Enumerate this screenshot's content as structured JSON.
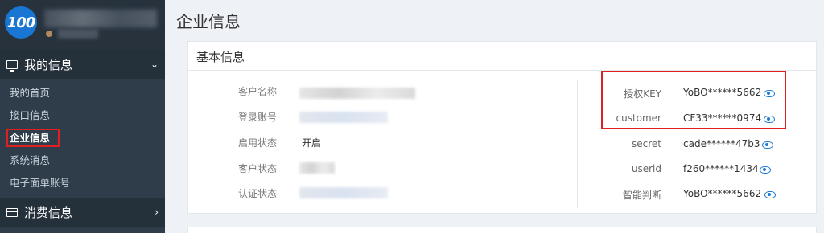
{
  "sidebar": {
    "logo_text": "100",
    "groups": [
      {
        "label": "我的信息",
        "icon": "monitor-icon",
        "chevron": "⌄"
      },
      {
        "label": "消费信息",
        "icon": "card-icon",
        "chevron": "›"
      }
    ],
    "items": [
      {
        "label": "我的首页"
      },
      {
        "label": "接口信息"
      },
      {
        "label": "企业信息",
        "active": true
      },
      {
        "label": "系统消息"
      },
      {
        "label": "电子面单账号"
      }
    ]
  },
  "main": {
    "page_title": "企业信息",
    "panel_title": "基本信息",
    "left_fields": [
      {
        "label": "客户名称",
        "value": ""
      },
      {
        "label": "登录账号",
        "value": ""
      },
      {
        "label": "启用状态",
        "value": "开启"
      },
      {
        "label": "客户状态",
        "value": ""
      },
      {
        "label": "认证状态",
        "value": ""
      }
    ],
    "right_fields": [
      {
        "label": "授权KEY",
        "value": "YoBO******5662"
      },
      {
        "label": "customer",
        "value": "CF33******0974"
      },
      {
        "label": "secret",
        "value": "cade******47b3"
      },
      {
        "label": "userid",
        "value": "f260******1434"
      },
      {
        "label": "智能判断",
        "value": "YoBO******5662"
      }
    ]
  },
  "colors": {
    "sidebar_bg": "#2f3d4a",
    "accent": "#1e7bd0",
    "highlight": "#e02020"
  }
}
